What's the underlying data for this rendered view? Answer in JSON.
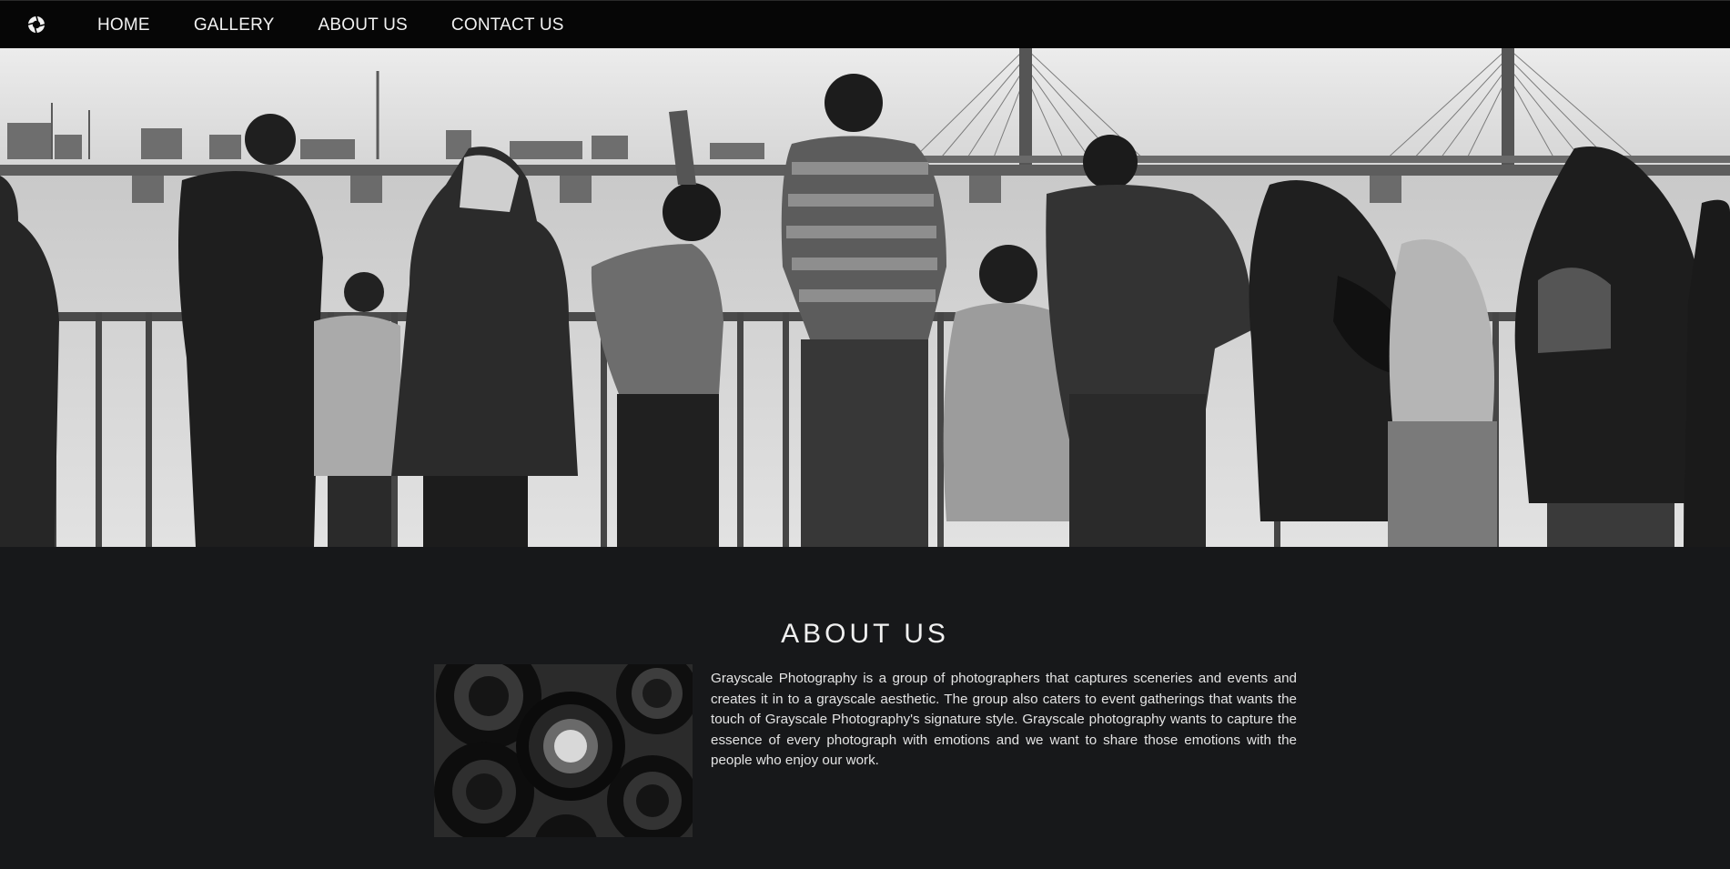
{
  "nav": {
    "logo_icon": "camera-aperture-icon",
    "items": [
      {
        "label": "HOME"
      },
      {
        "label": "GALLERY"
      },
      {
        "label": "ABOUT US"
      },
      {
        "label": "CONTACT US"
      }
    ]
  },
  "hero": {
    "image_subject": "grayscale photo of people at a riverside railing with bridges"
  },
  "about": {
    "title": "ABOUT US",
    "image_subject": "grayscale camera lenses",
    "text": "Grayscale Photography is a group of photographers that captures sceneries and events and creates it in to a grayscale aesthetic. The group also caters to event gatherings that wants the touch of Grayscale Photography's signature style. Grayscale photography wants to capture the essence of every photograph with emotions and we want to share those emotions with the people who enjoy our work."
  },
  "colors": {
    "nav_bg": "#060606",
    "page_bg": "#17181a",
    "text": "#e8e8e8"
  }
}
